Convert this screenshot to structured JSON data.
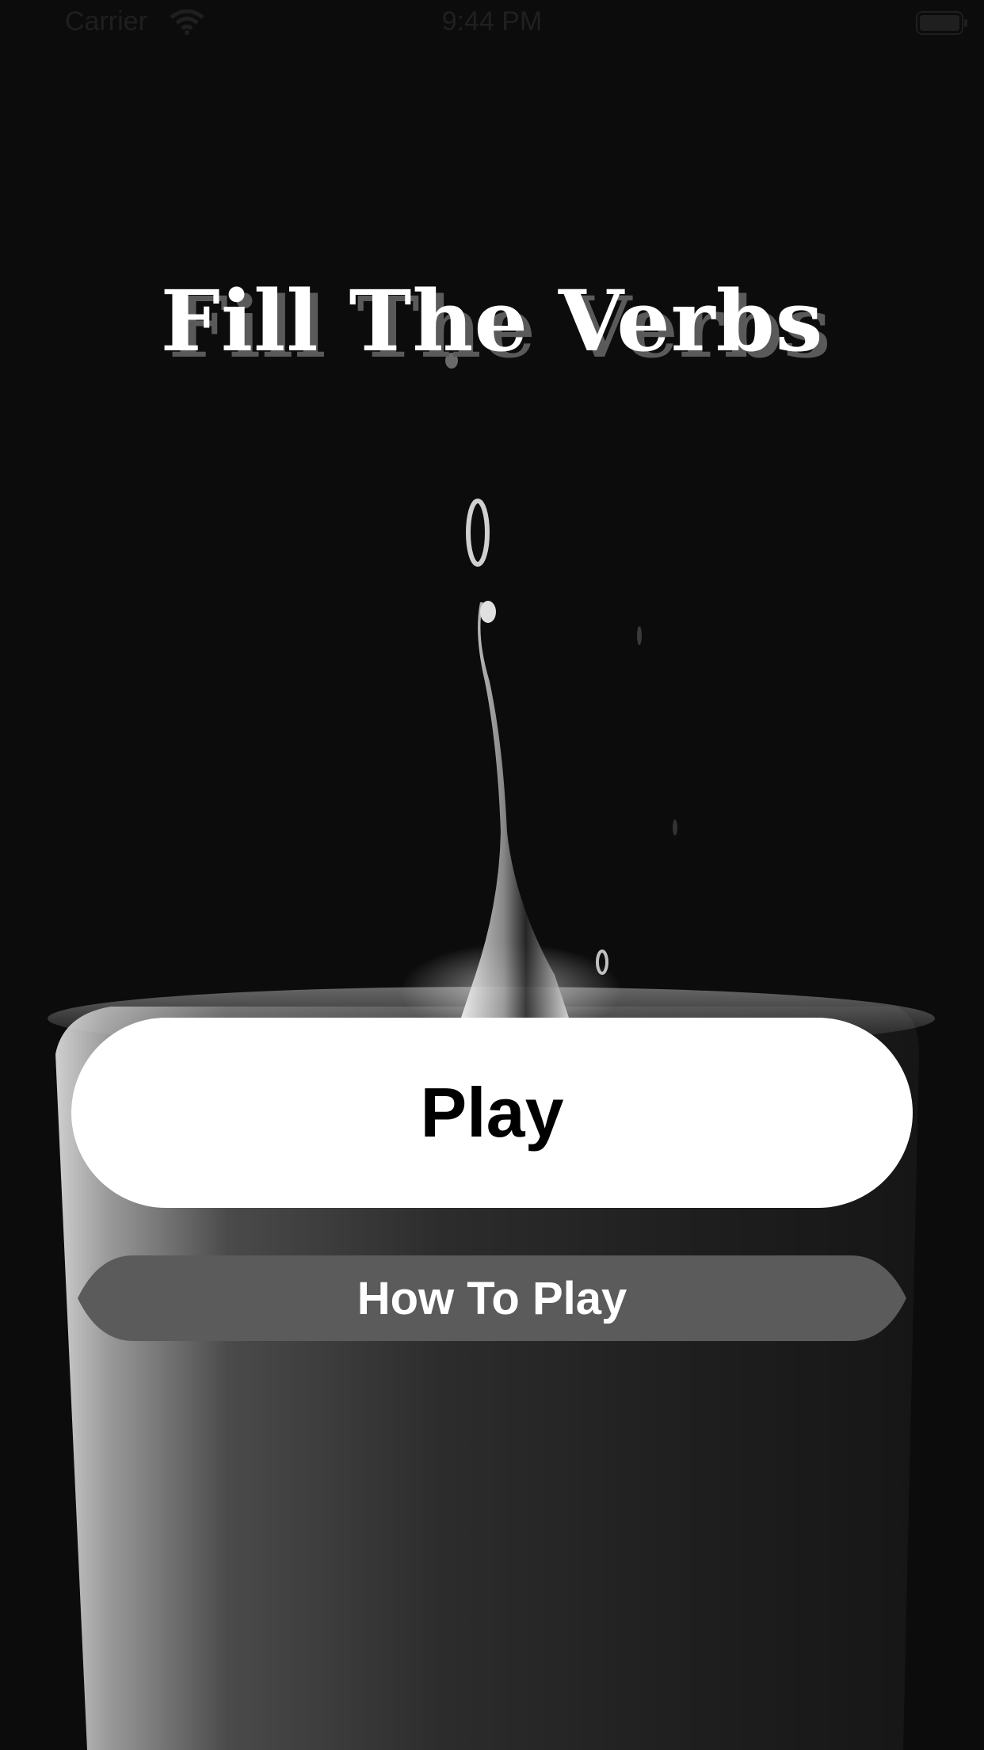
{
  "status_bar": {
    "carrier": "Carrier",
    "time": "9:44 PM",
    "wifi_icon": "wifi-icon",
    "battery_icon": "battery-icon"
  },
  "title": "Fill The Verbs",
  "buttons": {
    "play_label": "Play",
    "how_to_play_label": "How To Play"
  },
  "colors": {
    "background": "#0c0c0c",
    "play_button": "#ffffff",
    "how_to_play_button": "#5b5b5b",
    "title_shadow": "#5a5a5a"
  }
}
